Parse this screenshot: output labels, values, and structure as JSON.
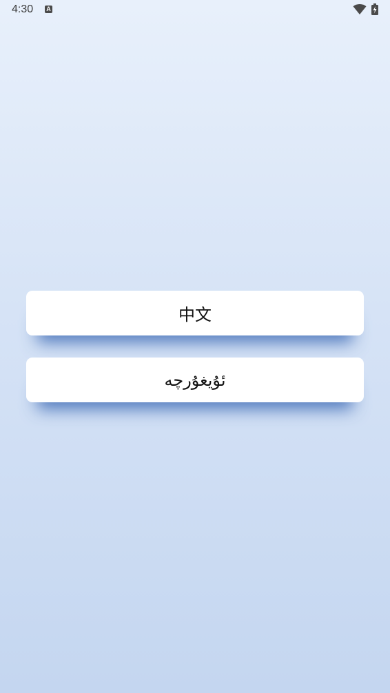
{
  "status_bar": {
    "time": "4:30",
    "app_icon_letter": "A",
    "icons": [
      "wifi-icon",
      "battery-charging-icon"
    ]
  },
  "language_options": [
    {
      "label": "中文"
    },
    {
      "label": "ئۇيغۇرچە"
    }
  ]
}
